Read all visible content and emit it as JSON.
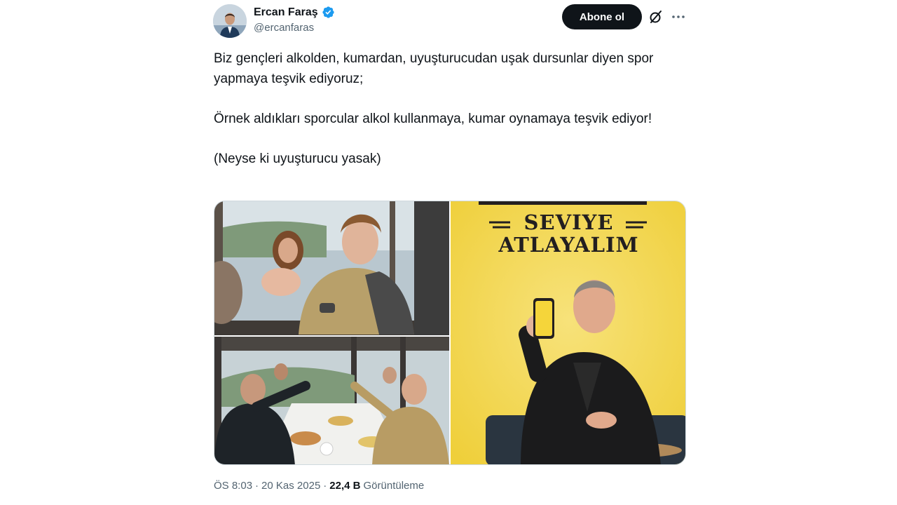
{
  "author": {
    "name": "Ercan Faraş",
    "handle": "@ercanfaras",
    "verified": true
  },
  "actions": {
    "follow_label": "Abone ol"
  },
  "tweet": {
    "paragraphs": [
      "Biz gençleri alkolden, kumardan, uyuşturucudan uşak dursunlar diyen spor yapmaya teşvik ediyoruz;",
      "Örnek aldıkları sporcular alkol kullanmaya, kumar oynamaya teşvik ediyor!",
      "(Neyse ki uyuşturucu yasak)"
    ]
  },
  "media": {
    "promo_line1": "SEVIYE",
    "promo_line2": "ATLAYALIM"
  },
  "meta": {
    "time": "ÖS 8:03",
    "separator": "·",
    "date": "20 Kas 2025",
    "views_count": "22,4 B",
    "views_label": "Görüntüleme"
  },
  "colors": {
    "text": "#0f1419",
    "secondary": "#536471",
    "verified": "#1d9bf0",
    "button_bg": "#0f1419",
    "promo_yellow": "#f3d84c"
  },
  "icons": [
    "verified-badge-icon",
    "grok-icon",
    "more-icon"
  ]
}
